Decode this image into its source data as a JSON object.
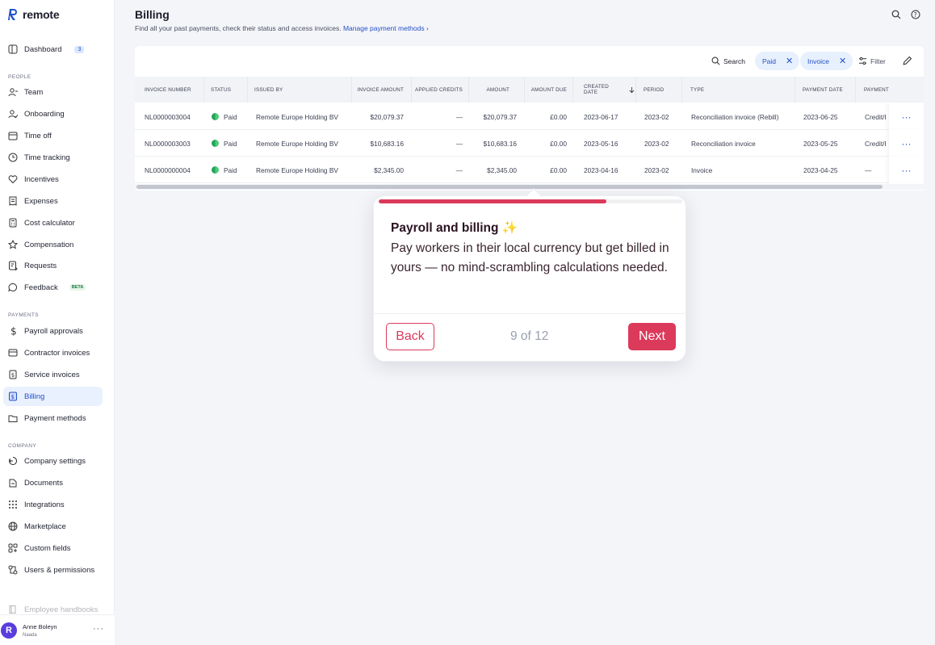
{
  "app": {
    "logo_text": "remote"
  },
  "sidebar": {
    "items": [
      {
        "label": "Dashboard",
        "icon": "dashboard-icon",
        "badge": "3"
      },
      {
        "label": "Team",
        "icon": "team-icon"
      },
      {
        "label": "Onboarding",
        "icon": "onboarding-icon"
      },
      {
        "label": "Time off",
        "icon": "calendar-icon"
      },
      {
        "label": "Time tracking",
        "icon": "clock-icon"
      },
      {
        "label": "Incentives",
        "icon": "heart-icon"
      },
      {
        "label": "Expenses",
        "icon": "receipt-icon"
      },
      {
        "label": "Cost calculator",
        "icon": "calculator-icon"
      },
      {
        "label": "Compensation",
        "icon": "star-icon"
      },
      {
        "label": "Requests",
        "icon": "requests-icon"
      },
      {
        "label": "Feedback",
        "icon": "chat-icon",
        "badge": "BETA"
      },
      {
        "label": "Payroll approvals",
        "icon": "dollar-icon"
      },
      {
        "label": "Contractor invoices",
        "icon": "invoice-icon"
      },
      {
        "label": "Service invoices",
        "icon": "service-invoice-icon"
      },
      {
        "label": "Billing",
        "icon": "billing-icon"
      },
      {
        "label": "Payment methods",
        "icon": "folder-icon"
      },
      {
        "label": "Company settings",
        "icon": "settings-icon"
      },
      {
        "label": "Documents",
        "icon": "documents-icon"
      },
      {
        "label": "Integrations",
        "icon": "grid-icon"
      },
      {
        "label": "Marketplace",
        "icon": "globe-icon"
      },
      {
        "label": "Custom fields",
        "icon": "custom-fields-icon"
      },
      {
        "label": "Users & permissions",
        "icon": "users-permissions-icon"
      },
      {
        "label": "Employee handbooks",
        "icon": "book-icon"
      }
    ],
    "sections": {
      "people": "PEOPLE",
      "payments": "PAYMENTS",
      "company": "COMPANY"
    },
    "user": {
      "initial": "R",
      "name": "Anne Boleyn",
      "company": "Naada",
      "more": "···"
    }
  },
  "header": {
    "title": "Billing",
    "subtitle": "Find all your past payments, check their status and access invoices.",
    "link": "Manage payment methods ›"
  },
  "toolbar": {
    "search_label": "Search",
    "chips": [
      "Paid",
      "Invoice"
    ],
    "filter_label": "Filter"
  },
  "table": {
    "columns": [
      "INVOICE NUMBER",
      "STATUS",
      "ISSUED BY",
      "INVOICE AMOUNT",
      "APPLIED CREDITS",
      "AMOUNT",
      "AMOUNT DUE",
      "CREATED DATE",
      "PERIOD",
      "TYPE",
      "PAYMENT DATE",
      "PAYMENT"
    ],
    "rows": [
      [
        "NL0000003004",
        "Paid",
        "Remote Europe Holding BV",
        "$20,079.37",
        "—",
        "$20,079.37",
        "£0.00",
        "2023-06-17",
        "2023-02",
        "Reconciliation invoice (Rebill)",
        "2023-06-25",
        "Credit/I"
      ],
      [
        "NL0000003003",
        "Paid",
        "Remote Europe Holding BV",
        "$10,683.16",
        "—",
        "$10,683.16",
        "£0.00",
        "2023-05-16",
        "2023-02",
        "Reconciliation invoice",
        "2023-05-25",
        "Credit/I"
      ],
      [
        "NL0000000004",
        "Paid",
        "Remote Europe Holding BV",
        "$2,345.00",
        "—",
        "$2,345.00",
        "£0.00",
        "2023-04-16",
        "2023-02",
        "Invoice",
        "2023-04-25",
        "—"
      ]
    ],
    "row_menu": "···"
  },
  "tour": {
    "title": "Payroll and billing ✨",
    "body": "Pay workers in their local currency but get billed in yours — no mind-scrambling calculations needed.",
    "back_label": "Back",
    "next_label": "Next",
    "step": "9 of 12",
    "progress": 0.75,
    "accent_color": "#dc3a5b"
  }
}
